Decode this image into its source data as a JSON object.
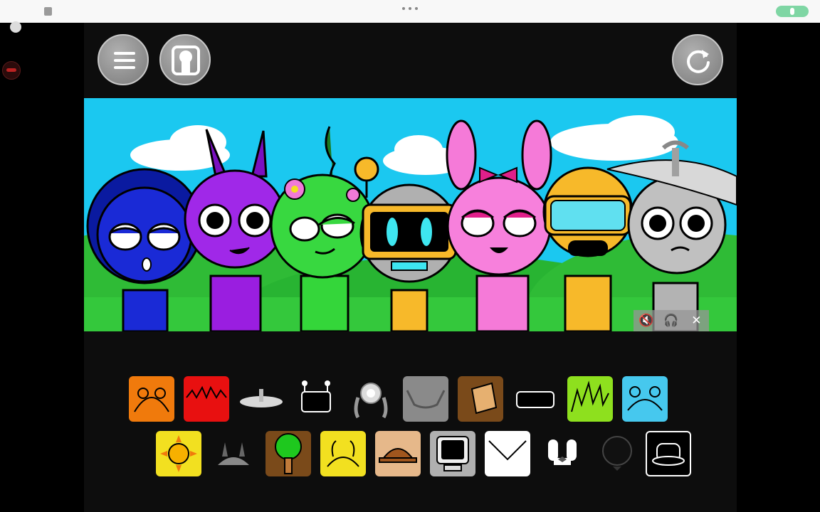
{
  "colors": {
    "sky": "#1bc8f0",
    "grass": "#2fcc3a",
    "button": "#8c8c8c"
  },
  "toolbar": {
    "menu_icon": "hamburger-icon",
    "avatar_icon": "character-icon",
    "reset_icon": "reset-icon"
  },
  "audio_controls": {
    "mute_icon": "mute-icon",
    "headphones_icon": "headphones-icon",
    "close_icon": "close-icon"
  },
  "characters": [
    {
      "name": "blue-hooded",
      "color": "#1a2ad6"
    },
    {
      "name": "purple-horned",
      "color": "#9a1ee0"
    },
    {
      "name": "green-vine",
      "color": "#34d63a"
    },
    {
      "name": "robot-visor",
      "color": "#b0b0b0"
    },
    {
      "name": "pink-bunny",
      "color": "#f57ad8"
    },
    {
      "name": "orange-goggles",
      "color": "#f7b92a"
    },
    {
      "name": "gray-dish",
      "color": "#b3b3b3"
    }
  ],
  "palette_row1": [
    {
      "icon": "orange-ears-icon",
      "bg": "#f07a0c"
    },
    {
      "icon": "red-spikes-icon",
      "bg": "#e81010"
    },
    {
      "icon": "satellite-dish-icon",
      "bg": "transparent"
    },
    {
      "icon": "robot-antenna-icon",
      "bg": "transparent"
    },
    {
      "icon": "flower-icon",
      "bg": "transparent"
    },
    {
      "icon": "gray-horns-icon",
      "bg": "#8a8a8a"
    },
    {
      "icon": "bucket-icon",
      "bg": "#7a4a1a"
    },
    {
      "icon": "visor-icon",
      "bg": "transparent"
    },
    {
      "icon": "green-grass-icon",
      "bg": "#8ee01e"
    },
    {
      "icon": "bear-ears-icon",
      "bg": "#46c8ee"
    }
  ],
  "palette_row2": [
    {
      "icon": "sun-icon",
      "bg": "#f2e020"
    },
    {
      "icon": "viking-helmet-icon",
      "bg": "transparent"
    },
    {
      "icon": "tree-icon",
      "bg": "#7a4a1a"
    },
    {
      "icon": "yellow-antennae-icon",
      "bg": "#f2e020"
    },
    {
      "icon": "brown-hat-icon",
      "bg": "#e6b88a"
    },
    {
      "icon": "computer-icon",
      "bg": "#b0b0b0"
    },
    {
      "icon": "envelope-icon",
      "bg": "#ffffff"
    },
    {
      "icon": "white-ears-icon",
      "bg": "transparent"
    },
    {
      "icon": "black-ball-icon",
      "bg": "transparent"
    },
    {
      "icon": "top-hat-icon",
      "bg": "#000000"
    }
  ]
}
